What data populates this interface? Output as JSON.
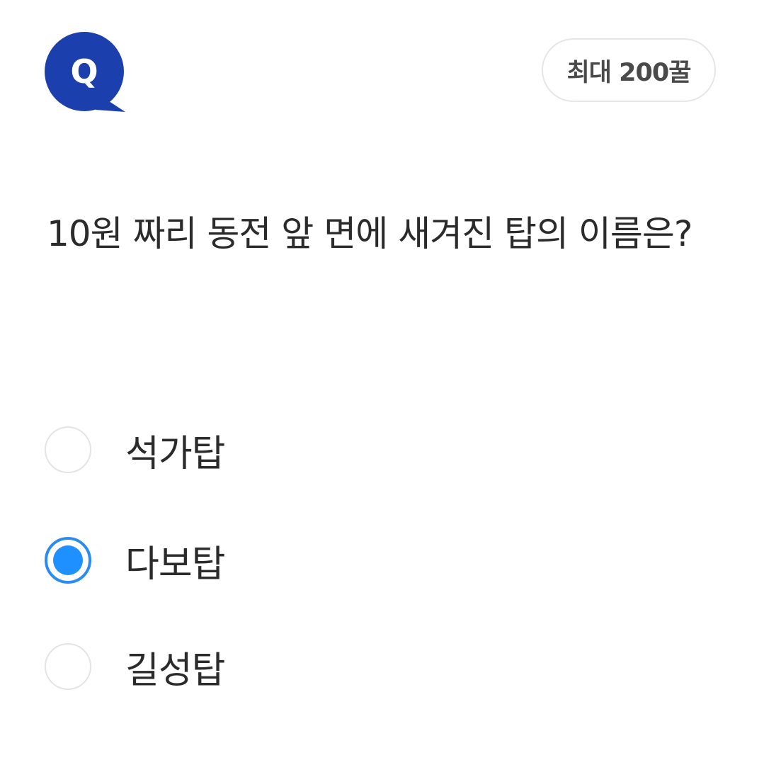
{
  "badge": {
    "letter": "Q",
    "icon": "q-speech-bubble-icon",
    "color": "#1c3fae"
  },
  "reward": {
    "label": "최대 200꿀"
  },
  "question": {
    "text": "10원 짜리 동전 앞 면에 새겨진 탑의 이름은?"
  },
  "options": [
    {
      "label": "석가탑",
      "selected": false
    },
    {
      "label": "다보탑",
      "selected": true
    },
    {
      "label": "길성탑",
      "selected": false
    }
  ],
  "colors": {
    "accent": "#1e90ff",
    "badge": "#1c3fae",
    "text": "#2b2b2b"
  }
}
